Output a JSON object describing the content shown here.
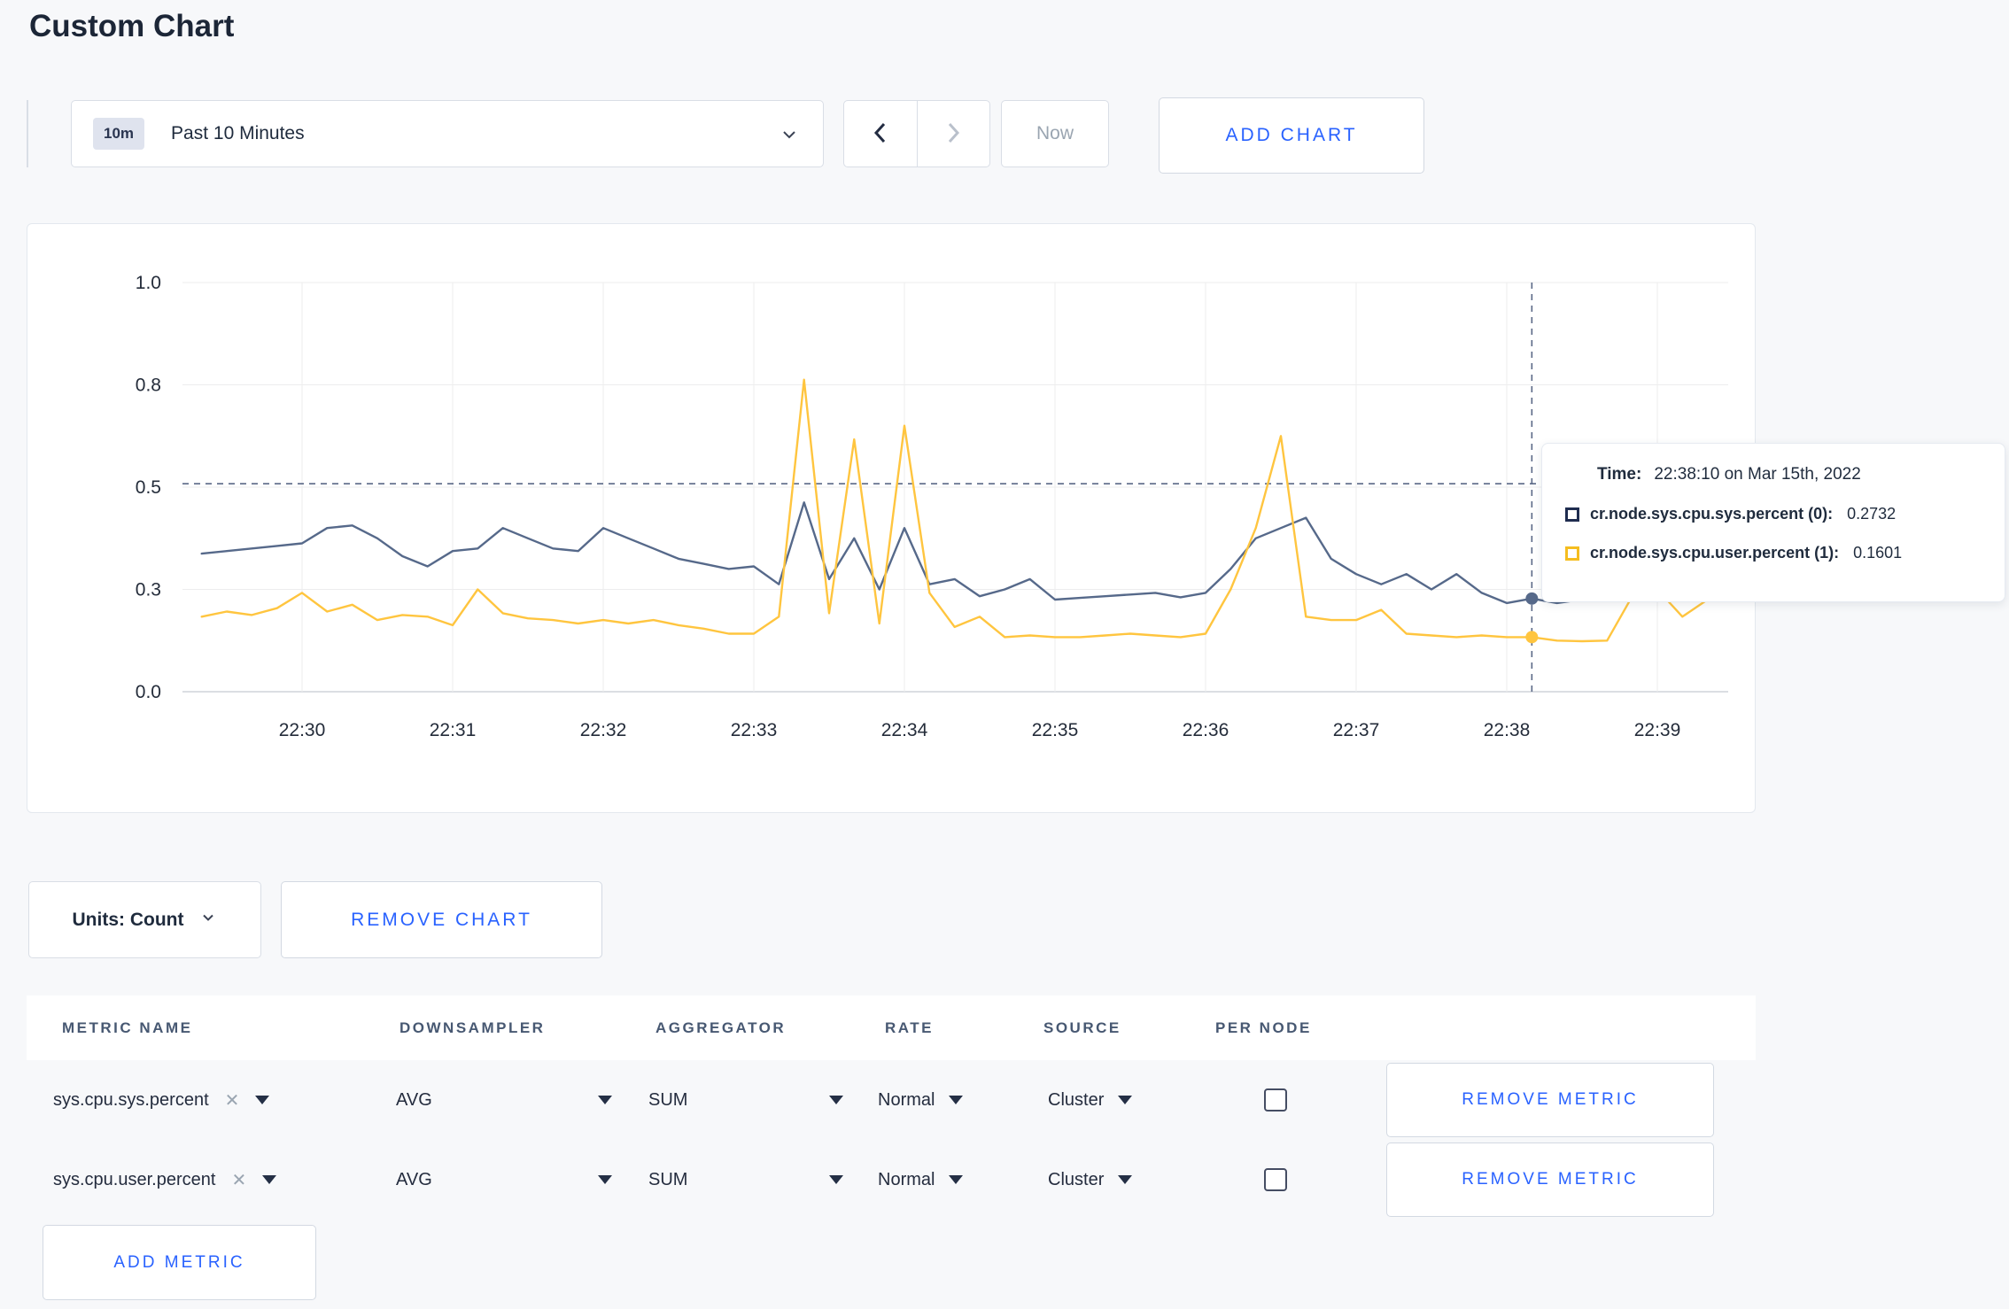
{
  "page": {
    "title": "Custom Chart"
  },
  "toolbar": {
    "range_badge": "10m",
    "range_label": "Past 10 Minutes",
    "prev_icon": "chevron-left",
    "next_icon": "chevron-right",
    "now_label": "Now",
    "add_chart_label": "ADD CHART"
  },
  "accent_color": "#2962ff",
  "tooltip": {
    "time_label": "Time:",
    "time_value": "22:38:10 on Mar 15th, 2022",
    "series": [
      {
        "label": "cr.node.sys.cpu.sys.percent (0):",
        "value": "0.2732",
        "color": "#1f2c4f"
      },
      {
        "label": "cr.node.sys.cpu.user.percent (1):",
        "value": "0.1601",
        "color": "#f5bd1f"
      }
    ]
  },
  "chart_data": {
    "type": "line",
    "title": "",
    "xlabel": "",
    "ylabel": "",
    "x_ticks": [
      "22:30",
      "22:31",
      "22:32",
      "22:33",
      "22:34",
      "22:35",
      "22:36",
      "22:37",
      "22:38",
      "22:39"
    ],
    "y_axis": {
      "tick_values": [
        0,
        0.3,
        0.5,
        0.8,
        1.0
      ],
      "tick_labels": [
        "0.0",
        "0.3",
        "0.5",
        "0.8",
        "1.0"
      ],
      "note": "ticks rendered equally spaced (nonlinear value scale)"
    },
    "grid": true,
    "start_time": "22:29:20",
    "interval_seconds": 10,
    "samples_before_first_tick": 4,
    "series": [
      {
        "name": "cr.node.sys.cpu.sys.percent (0)",
        "color": "#56698a",
        "values": [
          0.37,
          0.375,
          0.38,
          0.385,
          0.39,
          0.42,
          0.425,
          0.4,
          0.365,
          0.345,
          0.375,
          0.38,
          0.42,
          0.4,
          0.38,
          0.375,
          0.42,
          0.4,
          0.38,
          0.36,
          0.35,
          0.34,
          0.345,
          0.31,
          0.47,
          0.32,
          0.4,
          0.3,
          0.42,
          0.31,
          0.32,
          0.28,
          0.3,
          0.32,
          0.27,
          0.275,
          0.28,
          0.285,
          0.29,
          0.277,
          0.29,
          0.34,
          0.4,
          0.42,
          0.44,
          0.36,
          0.33,
          0.31,
          0.33,
          0.3,
          0.33,
          0.29,
          0.26,
          0.2732,
          0.26,
          0.27,
          0.29,
          0.3,
          0.3,
          0.285,
          0.31
        ]
      },
      {
        "name": "cr.node.sys.cpu.user.percent (1)",
        "color": "#ffc53f",
        "values": [
          0.22,
          0.235,
          0.225,
          0.245,
          0.29,
          0.235,
          0.255,
          0.21,
          0.225,
          0.22,
          0.195,
          0.3,
          0.23,
          0.215,
          0.21,
          0.2,
          0.21,
          0.2,
          0.21,
          0.195,
          0.185,
          0.17,
          0.17,
          0.22,
          0.81,
          0.23,
          0.64,
          0.2,
          0.68,
          0.29,
          0.19,
          0.22,
          0.16,
          0.165,
          0.16,
          0.16,
          0.165,
          0.17,
          0.165,
          0.16,
          0.17,
          0.3,
          0.42,
          0.65,
          0.22,
          0.21,
          0.21,
          0.24,
          0.17,
          0.165,
          0.16,
          0.165,
          0.16,
          0.1601,
          0.15,
          0.148,
          0.15,
          0.28,
          0.3,
          0.22,
          0.27
        ]
      }
    ],
    "crosshair": {
      "time": "22:38:10",
      "sample_index": 53,
      "hover_value": 0.51,
      "values": {
        "sys": 0.2732,
        "user": 0.1601
      }
    },
    "legend_position": "tooltip-only"
  },
  "chart_controls": {
    "units_label": "Units: Count",
    "remove_chart_label": "REMOVE CHART"
  },
  "metrics_table": {
    "headers": [
      "METRIC NAME",
      "DOWNSAMPLER",
      "AGGREGATOR",
      "RATE",
      "SOURCE",
      "PER NODE"
    ],
    "rows": [
      {
        "metric": "sys.cpu.sys.percent",
        "remove_tag": "✕",
        "downsampler": "AVG",
        "aggregator": "SUM",
        "rate": "Normal",
        "source": "Cluster",
        "per_node_checked": false,
        "remove_label": "REMOVE METRIC"
      },
      {
        "metric": "sys.cpu.user.percent",
        "remove_tag": "✕",
        "downsampler": "AVG",
        "aggregator": "SUM",
        "rate": "Normal",
        "source": "Cluster",
        "per_node_checked": false,
        "remove_label": "REMOVE METRIC"
      }
    ],
    "add_metric_label": "ADD METRIC"
  }
}
